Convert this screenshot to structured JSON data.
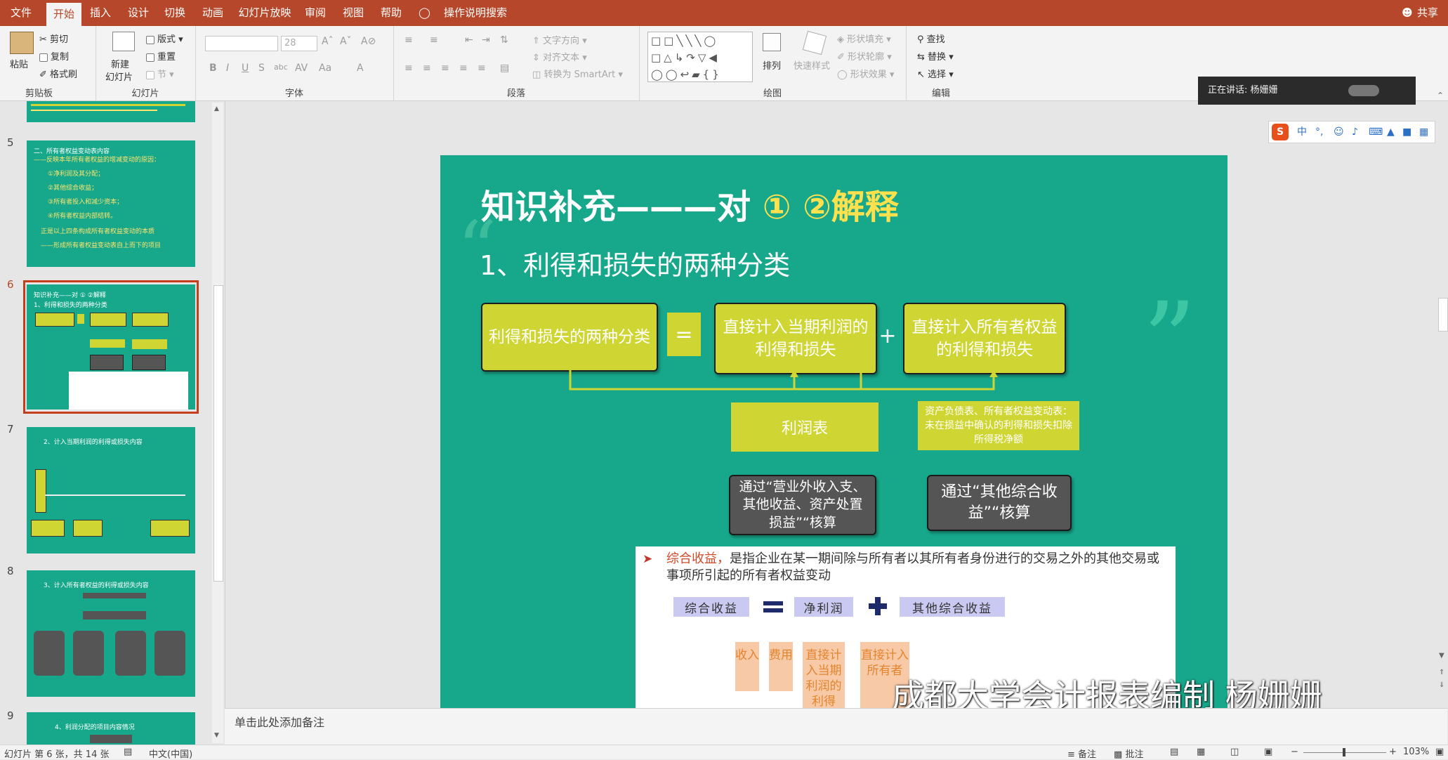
{
  "tabs": {
    "file": "文件",
    "home": "开始",
    "insert": "插入",
    "design": "设计",
    "transitions": "切换",
    "animations": "动画",
    "slideshow": "幻灯片放映",
    "review": "审阅",
    "view": "视图",
    "help": "帮助",
    "tellme": "操作说明搜索",
    "share": "共享"
  },
  "ribbon": {
    "clipboard": {
      "paste": "粘贴",
      "cut": "剪切",
      "copy": "复制",
      "format_painter": "格式刷",
      "label": "剪贴板"
    },
    "slides": {
      "new_slide": "新建",
      "new_slide2": "幻灯片",
      "layout": "版式",
      "reset": "重置",
      "section": "节",
      "label": "幻灯片"
    },
    "font": {
      "size": "28",
      "label": "字体"
    },
    "paragraph": {
      "text_direction": "文字方向",
      "align_text": "对齐文本",
      "smartart": "转换为 SmartArt",
      "label": "段落"
    },
    "drawing": {
      "arrange": "排列",
      "quick_styles": "快速样式",
      "shape_fill": "形状填充",
      "shape_outline": "形状轮廓",
      "shape_effects": "形状效果",
      "label": "绘图"
    },
    "editing": {
      "find": "查找",
      "replace": "替换",
      "select": "选择",
      "label": "编辑"
    }
  },
  "speaking_banner": "正在讲话: 杨姗姗",
  "thumbnails": [
    {
      "num": "5",
      "title": "二、所有者权益变动表内容",
      "line1": "——反映本年所有者权益的增减变动的原因：",
      "items": [
        "①净利润及其分配；",
        "②其他综合收益；",
        "③所有者投入和减少资本；",
        "④所有者权益内部结转。"
      ],
      "tail1": "正是以上四条构成所有者权益变动的本质",
      "tail2": "——形成所有者权益变动表自上而下的项目"
    },
    {
      "num": "6",
      "title": "知识补充——对 ① ②解释",
      "sub": "1、利得和损失的两种分类"
    },
    {
      "num": "7",
      "title": "2、计入当期利润的利得或损失内容"
    },
    {
      "num": "8",
      "title": "3、计入所有者权益的利得或损失内容"
    },
    {
      "num": "9",
      "title": "4、利润分配的项目内容情况"
    }
  ],
  "slide": {
    "title_white": "知识补充———对",
    "title_yellow": "① ②解释",
    "subtitle": "1、利得和损失的两种分类",
    "box_main": "利得和损失的两种分类",
    "eq_sign": "=",
    "box_current": "直接计入当期利润的利得和损失",
    "plus_sign": "+",
    "box_equity": "直接计入所有者权益的利得和损失",
    "income_statement": "利润表",
    "balance_sheet_note": "资产负债表、所有者权益变动表：未在损益中确认的利得和损失扣除所得税净额",
    "via_nonop": "通过“营业外收入支、其他收益、资产处置损益”“核算",
    "via_oci": "通过“其他综合收益”“核算",
    "definition_label": "综合收益，",
    "definition_text": "是指企业在某一期间除与所有者以其所有者身份进行的交易之外的其他交易或事项所引起的所有者权益变动",
    "comprehensive_income": "综合收益",
    "net_profit": "净利润",
    "oci": "其他综合收益",
    "income": "收入",
    "expense": "费用",
    "direct_profit": "直接计入当期利润的利得",
    "direct_equity": "直接计入所有者",
    "watermark": "成都大学会计报表编制 杨姗姗"
  },
  "notes_placeholder": "单击此处添加备注",
  "status": {
    "slide_info": "幻灯片 第 6 张，共 14 张",
    "language": "中文(中国)",
    "notes": "备注",
    "comments": "批注",
    "zoom": "103%"
  },
  "ime": {
    "mode": "中"
  },
  "colors": {
    "accent": "#b7472a",
    "slide_bg": "#17a88b",
    "box_yellow": "#cfd633",
    "title_yellow": "#ffe14d"
  }
}
